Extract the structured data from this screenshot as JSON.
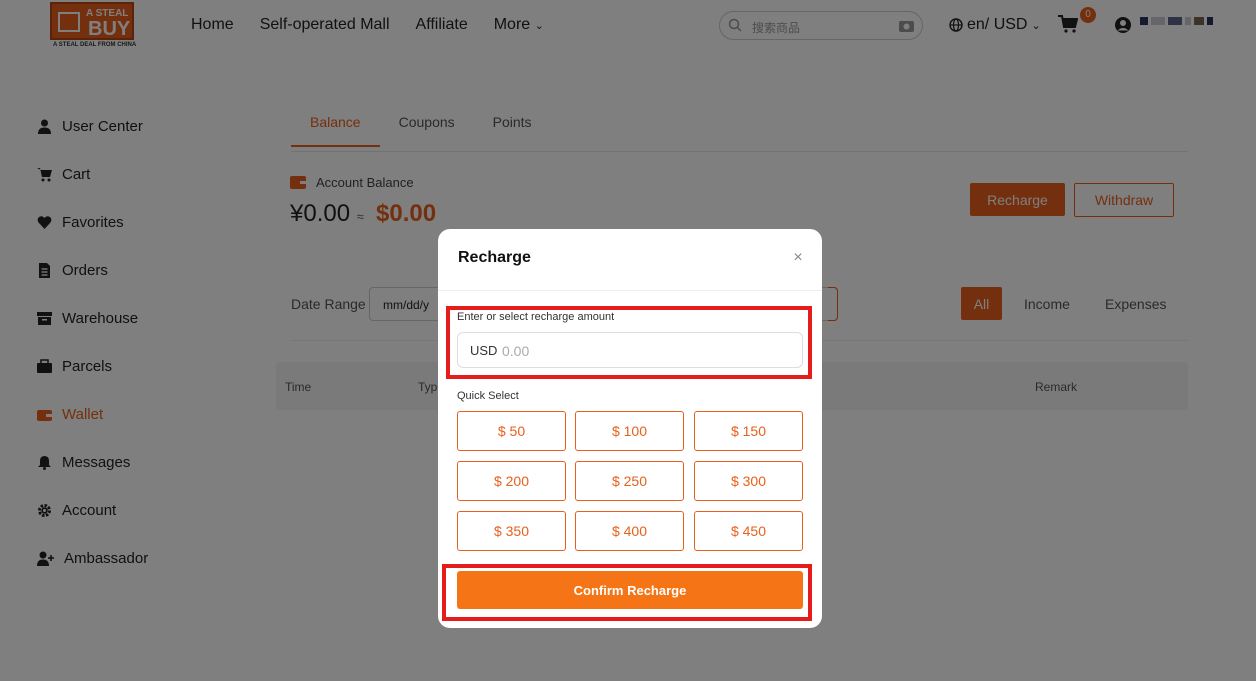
{
  "header": {
    "logo": {
      "top": "A STEAL",
      "main": "BUY",
      "tagline": "A STEAL DEAL FROM CHINA"
    },
    "nav": [
      "Home",
      "Self-operated Mall",
      "Affiliate",
      "More"
    ],
    "search_placeholder": "搜索商品",
    "lang_currency": "en/ USD",
    "cart_count": "0"
  },
  "sidebar": {
    "items": [
      {
        "label": "User Center",
        "icon": "user-icon"
      },
      {
        "label": "Cart",
        "icon": "cart-icon"
      },
      {
        "label": "Favorites",
        "icon": "heart-icon"
      },
      {
        "label": "Orders",
        "icon": "document-icon"
      },
      {
        "label": "Warehouse",
        "icon": "warehouse-icon"
      },
      {
        "label": "Parcels",
        "icon": "parcel-icon"
      },
      {
        "label": "Wallet",
        "icon": "wallet-icon",
        "active": true
      },
      {
        "label": "Messages",
        "icon": "bell-icon"
      },
      {
        "label": "Account",
        "icon": "gear-icon"
      },
      {
        "label": "Ambassador",
        "icon": "user-plus-icon"
      }
    ]
  },
  "main": {
    "tabs": [
      "Balance",
      "Coupons",
      "Points"
    ],
    "account_label": "Account Balance",
    "balance_rmb": "¥0.00",
    "approx": "≈",
    "balance_usd": "$0.00",
    "recharge_label": "Recharge",
    "withdraw_label": "Withdraw",
    "date_range_label": "Date Range",
    "date_placeholder": "mm/dd/y",
    "filters": [
      "All",
      "Income",
      "Expenses"
    ],
    "table_headers": [
      "Time",
      "Typ",
      "Remark"
    ]
  },
  "modal": {
    "title": "Recharge",
    "close": "×",
    "amount_label": "Enter or select recharge amount",
    "currency": "USD",
    "amount_placeholder": "0.00",
    "quick_select_label": "Quick Select",
    "options": [
      "$ 50",
      "$ 100",
      "$ 150",
      "$ 200",
      "$ 250",
      "$ 300",
      "$ 350",
      "$ 400",
      "$ 450"
    ],
    "confirm_label": "Confirm Recharge"
  },
  "colors": {
    "accent": "#e8601c",
    "confirm": "#f57516",
    "highlight": "#e51c1c"
  }
}
